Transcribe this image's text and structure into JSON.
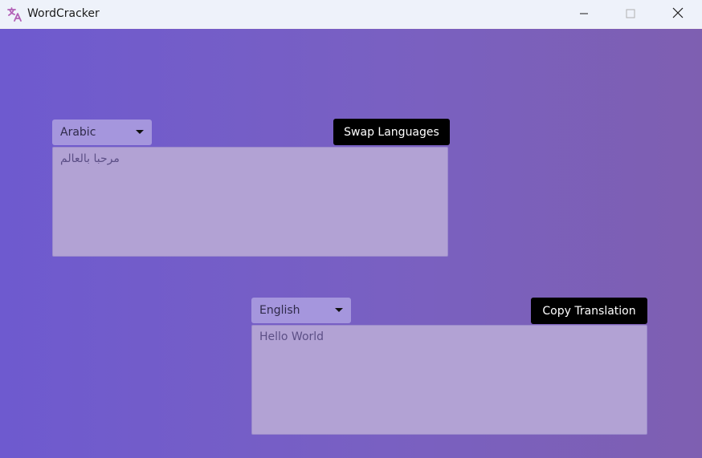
{
  "window": {
    "title": "WordCracker",
    "icon": "translate-icon",
    "controls": [
      "minimize-icon",
      "maximize-icon",
      "close-icon"
    ]
  },
  "source": {
    "language": "Arabic",
    "text": "مرحبا بالعالم"
  },
  "target": {
    "language": "English",
    "text": "Hello World"
  },
  "buttons": {
    "swap_label": "Swap Languages",
    "copy_label": "Copy Translation"
  },
  "colors": {
    "gradient_start": "#6e5acf",
    "gradient_end": "#7e5fb1",
    "button_bg": "#000000",
    "textbox_bg": "#b2a2d4",
    "select_bg": "#a596dd"
  }
}
